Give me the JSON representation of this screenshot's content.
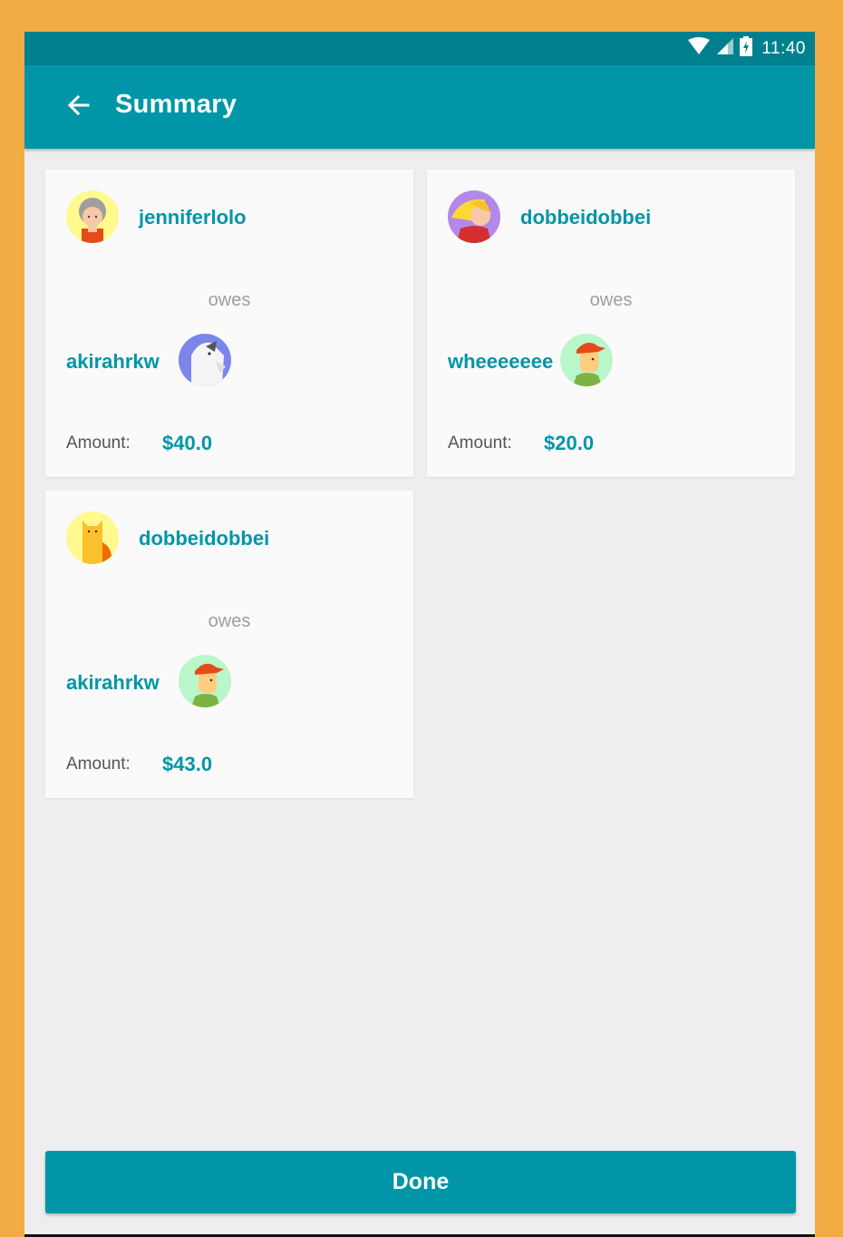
{
  "status_bar": {
    "time": "11:40",
    "icons": [
      "wifi-icon",
      "signal-icon",
      "battery-charging-icon"
    ]
  },
  "toolbar": {
    "back_icon": "arrow-back-icon",
    "title": "Summary"
  },
  "cards": [
    {
      "from_user": "jenniferlolo",
      "from_avatar": "grandma-avatar",
      "relation": "owes",
      "to_user": "akirahrkw",
      "to_avatar": "dog-avatar",
      "amount_label": "Amount:",
      "amount_value": "$40.0"
    },
    {
      "from_user": "dobbeidobbei",
      "from_avatar": "blonde-woman-avatar",
      "relation": "owes",
      "to_user": "wheeeeeee",
      "to_avatar": "cap-boy-avatar",
      "amount_label": "Amount:",
      "amount_value": "$20.0"
    },
    {
      "from_user": "dobbeidobbei",
      "from_avatar": "cat-avatar",
      "relation": "owes",
      "to_user": "akirahrkw",
      "to_avatar": "cap-boy-avatar",
      "amount_label": "Amount:",
      "amount_value": "$43.0"
    }
  ],
  "done_button": {
    "label": "Done"
  },
  "colors": {
    "frame": "#f2ac46",
    "status_bar": "#00808e",
    "primary": "#0096a7",
    "background": "#eeeeee",
    "card": "#fafafa"
  }
}
